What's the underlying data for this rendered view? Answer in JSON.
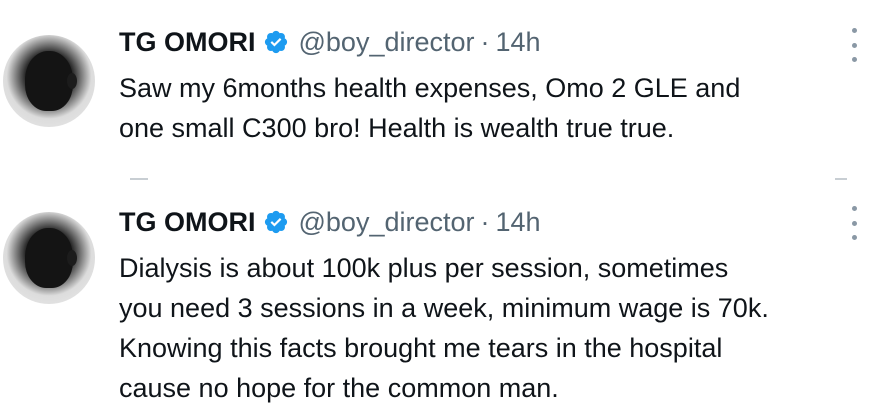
{
  "tweets": [
    {
      "author_name": "TG OMORI",
      "handle": "@boy_director",
      "separator": "·",
      "time": "14h",
      "text_lines": [
        "Saw my 6months health expenses, Omo 2 GLE and",
        "one small C300 bro! Health is wealth true true."
      ]
    },
    {
      "author_name": "TG OMORI",
      "handle": "@boy_director",
      "separator": "·",
      "time": "14h",
      "text_lines": [
        "Dialysis is about 100k plus per session, sometimes",
        "you need 3 sessions in a week, minimum wage is 70k.",
        "Knowing this facts brought me tears in the hospital",
        "cause no hope for the common man."
      ]
    }
  ],
  "icons": {
    "verified": "verified-badge-icon",
    "more": "more-options-icon"
  },
  "colors": {
    "verified_blue": "#1d9bf0",
    "text_primary": "#0f1419",
    "text_secondary": "#536471"
  }
}
